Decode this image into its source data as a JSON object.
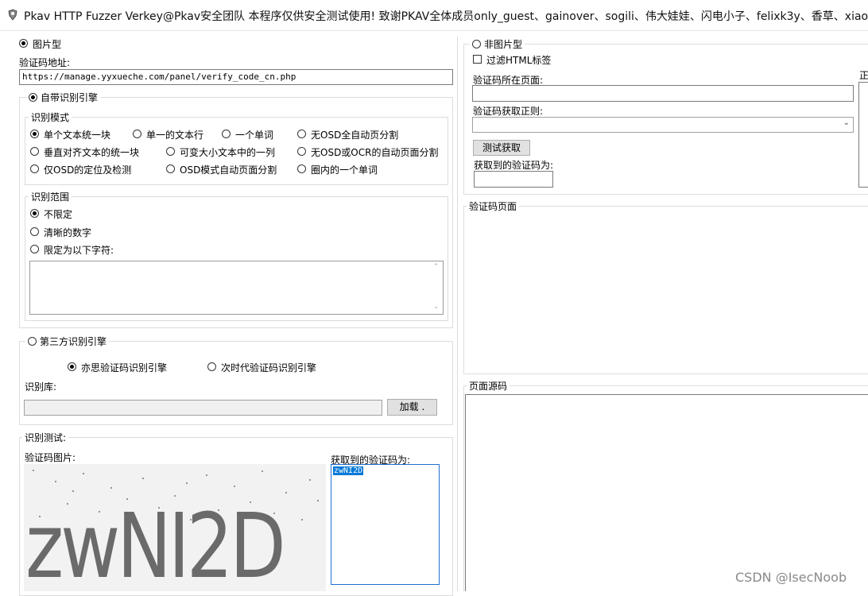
{
  "window": {
    "title": "Pkav HTTP Fuzzer   Verkey@Pkav安全团队  本程序仅供安全测试使用!  致谢PKAV全体成员only_guest、gainover、sogili、伟大娃娃、闪电小子、felixk3y、香草、xiaoL"
  },
  "left": {
    "image_type_label": "图片型",
    "captcha_url_label": "验证码地址:",
    "captcha_url_value": "https://manage.yyxueche.com/panel/verify_code_cn.php",
    "builtin_engine_label": "自带识别引擎",
    "mode_group_label": "识别模式",
    "modes": [
      "单个文本统一块",
      "单一的文本行",
      "一个单词",
      "无OSD全自动页分割",
      "垂直对齐文本的统一块",
      "可变大小文本中的一列",
      "无OSD或OCR的自动页面分割",
      "仅OSD的定位及检测",
      "OSD模式自动页面分割",
      "圈内的一个单词"
    ],
    "range_group_label": "识别范围",
    "ranges": [
      "不限定",
      "清晰的数字",
      "限定为以下字符:"
    ],
    "third_party_label": "第三方识别引擎",
    "engines": [
      "亦思验证码识别引擎",
      "次时代验证码识别引擎"
    ],
    "library_label": "识别库:",
    "load_button": "加载 .",
    "test_group_label": "识别测试:",
    "captcha_image_label": "验证码图片:",
    "captcha_text": "zwNI2D",
    "result_label": "获取到的验证码为:",
    "result_value": "zwNI2D"
  },
  "right": {
    "non_image_label": "非图片型",
    "filter_html_label": "过滤HTML标签",
    "page_label": "验证码所在页面:",
    "regex_label": "验证码获取正则:",
    "test_button": "测试获取",
    "got_label": "获取到的验证码为:",
    "side_label": "正",
    "captcha_page_group": "验证码页面",
    "source_group": "页面源码"
  },
  "watermark": "CSDN @IsecNoob"
}
